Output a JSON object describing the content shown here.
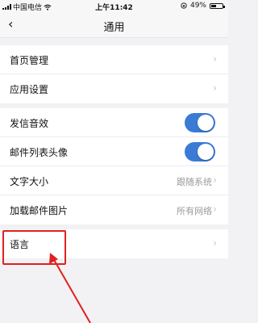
{
  "status_bar": {
    "carrier": "中国电信",
    "time": "上午11:42",
    "battery_text": "49%",
    "battery_level": 0.49
  },
  "nav": {
    "back_glyph": "‹",
    "title": "通用"
  },
  "groups": [
    {
      "items": [
        {
          "label": "首页管理"
        },
        {
          "label": "应用设置"
        }
      ]
    },
    {
      "items": [
        {
          "label": "发信音效",
          "toggle": true
        },
        {
          "label": "邮件列表头像",
          "toggle": true
        },
        {
          "label": "文字大小",
          "value": "跟随系统"
        },
        {
          "label": "加载邮件图片",
          "value": "所有网络"
        }
      ]
    },
    {
      "items": [
        {
          "label": "语言"
        }
      ]
    }
  ],
  "chevron_glyph": "›",
  "annotation_color": "#e02020",
  "toggle_color": "#3a7bd5"
}
